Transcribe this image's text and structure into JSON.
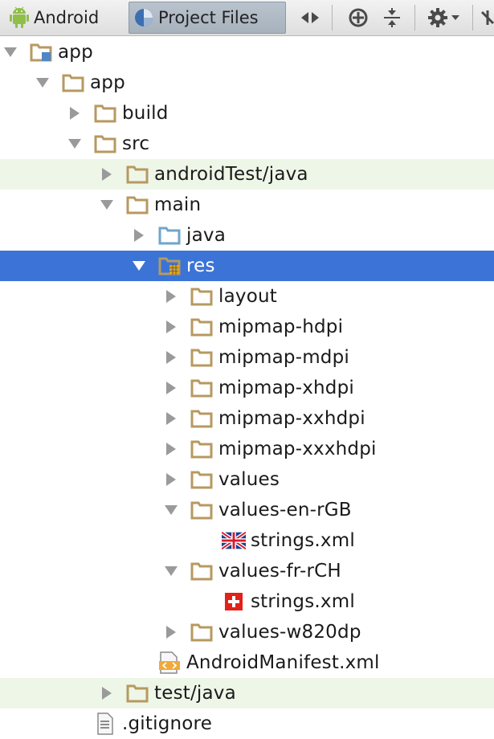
{
  "toolbar": {
    "tab_android": "Android",
    "tab_project_files": "Project Files",
    "buttons": [
      "arrows-left-right-icon",
      "crosshair-icon",
      "collapse-all-icon",
      "gear-icon"
    ]
  },
  "colors": {
    "folder": "#b79960",
    "source_folder": "#6fa6c8",
    "selection": "#3b74d6",
    "highlight_row": "#eef6e8",
    "arrow": "#9a9a9a"
  },
  "tree": [
    {
      "label": "app",
      "indent": 0,
      "arrow": "down",
      "icon": "module-folder-icon",
      "state": ""
    },
    {
      "label": "app",
      "indent": 1,
      "arrow": "down",
      "icon": "folder-icon",
      "state": ""
    },
    {
      "label": "build",
      "indent": 2,
      "arrow": "right",
      "icon": "folder-icon",
      "state": ""
    },
    {
      "label": "src",
      "indent": 2,
      "arrow": "down",
      "icon": "folder-icon",
      "state": ""
    },
    {
      "label": "androidTest/java",
      "indent": 3,
      "arrow": "right",
      "icon": "folder-icon",
      "state": "highlight"
    },
    {
      "label": "main",
      "indent": 3,
      "arrow": "down",
      "icon": "folder-icon",
      "state": ""
    },
    {
      "label": "java",
      "indent": 4,
      "arrow": "right",
      "icon": "source-folder-icon",
      "state": ""
    },
    {
      "label": "res",
      "indent": 4,
      "arrow": "down",
      "icon": "resource-folder-icon",
      "state": "selected"
    },
    {
      "label": "layout",
      "indent": 5,
      "arrow": "right",
      "icon": "folder-icon",
      "state": ""
    },
    {
      "label": "mipmap-hdpi",
      "indent": 5,
      "arrow": "right",
      "icon": "folder-icon",
      "state": ""
    },
    {
      "label": "mipmap-mdpi",
      "indent": 5,
      "arrow": "right",
      "icon": "folder-icon",
      "state": ""
    },
    {
      "label": "mipmap-xhdpi",
      "indent": 5,
      "arrow": "right",
      "icon": "folder-icon",
      "state": ""
    },
    {
      "label": "mipmap-xxhdpi",
      "indent": 5,
      "arrow": "right",
      "icon": "folder-icon",
      "state": ""
    },
    {
      "label": "mipmap-xxxhdpi",
      "indent": 5,
      "arrow": "right",
      "icon": "folder-icon",
      "state": ""
    },
    {
      "label": "values",
      "indent": 5,
      "arrow": "right",
      "icon": "folder-icon",
      "state": ""
    },
    {
      "label": "values-en-rGB",
      "indent": 5,
      "arrow": "down",
      "icon": "folder-icon",
      "state": ""
    },
    {
      "label": "strings.xml",
      "indent": 6,
      "arrow": "none",
      "icon": "uk-flag-icon",
      "state": ""
    },
    {
      "label": "values-fr-rCH",
      "indent": 5,
      "arrow": "down",
      "icon": "folder-icon",
      "state": ""
    },
    {
      "label": "strings.xml",
      "indent": 6,
      "arrow": "none",
      "icon": "swiss-flag-icon",
      "state": ""
    },
    {
      "label": "values-w820dp",
      "indent": 5,
      "arrow": "right",
      "icon": "folder-icon",
      "state": ""
    },
    {
      "label": "AndroidManifest.xml",
      "indent": 4,
      "arrow": "none",
      "icon": "manifest-file-icon",
      "state": ""
    },
    {
      "label": "test/java",
      "indent": 3,
      "arrow": "right",
      "icon": "folder-icon",
      "state": "highlight"
    },
    {
      "label": ".gitignore",
      "indent": 2,
      "arrow": "none",
      "icon": "text-file-icon",
      "state": ""
    }
  ]
}
